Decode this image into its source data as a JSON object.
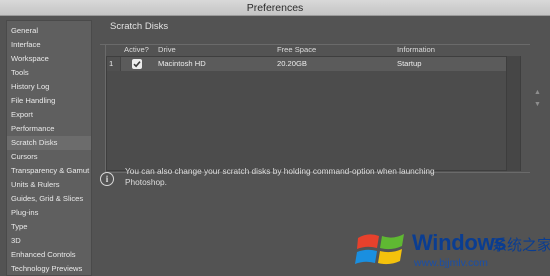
{
  "window": {
    "title": "Preferences"
  },
  "sidebar": {
    "items": [
      {
        "label": "General",
        "active": false
      },
      {
        "label": "Interface",
        "active": false
      },
      {
        "label": "Workspace",
        "active": false
      },
      {
        "label": "Tools",
        "active": false
      },
      {
        "label": "History Log",
        "active": false
      },
      {
        "label": "File Handling",
        "active": false
      },
      {
        "label": "Export",
        "active": false
      },
      {
        "label": "Performance",
        "active": false
      },
      {
        "label": "Scratch Disks",
        "active": true
      },
      {
        "label": "Cursors",
        "active": false
      },
      {
        "label": "Transparency & Gamut",
        "active": false
      },
      {
        "label": "Units & Rulers",
        "active": false
      },
      {
        "label": "Guides, Grid & Slices",
        "active": false
      },
      {
        "label": "Plug-ins",
        "active": false
      },
      {
        "label": "Type",
        "active": false
      },
      {
        "label": "3D",
        "active": false
      },
      {
        "label": "Enhanced Controls",
        "active": false
      },
      {
        "label": "Technology Previews",
        "active": false
      }
    ]
  },
  "scratch": {
    "section_title": "Scratch Disks",
    "columns": {
      "active": "Active?",
      "drive": "Drive",
      "free_space": "Free Space",
      "information": "Information"
    },
    "rows": [
      {
        "index": "1",
        "active": true,
        "drive": "Macintosh HD",
        "free_space": "20.20GB",
        "information": "Startup"
      }
    ],
    "reorder": {
      "up": "▲",
      "down": "▼"
    }
  },
  "info": {
    "icon": "info-icon",
    "glyph": "i",
    "text": "You can also change your scratch disks by holding command-option when launching Photoshop."
  },
  "watermark": {
    "title": "Windows",
    "subtitle_cn": "系统之家",
    "url": "www.bjjmlv.com",
    "colors": [
      "#e8412c",
      "#5fb832",
      "#1a8fe0",
      "#f5c20c"
    ]
  }
}
